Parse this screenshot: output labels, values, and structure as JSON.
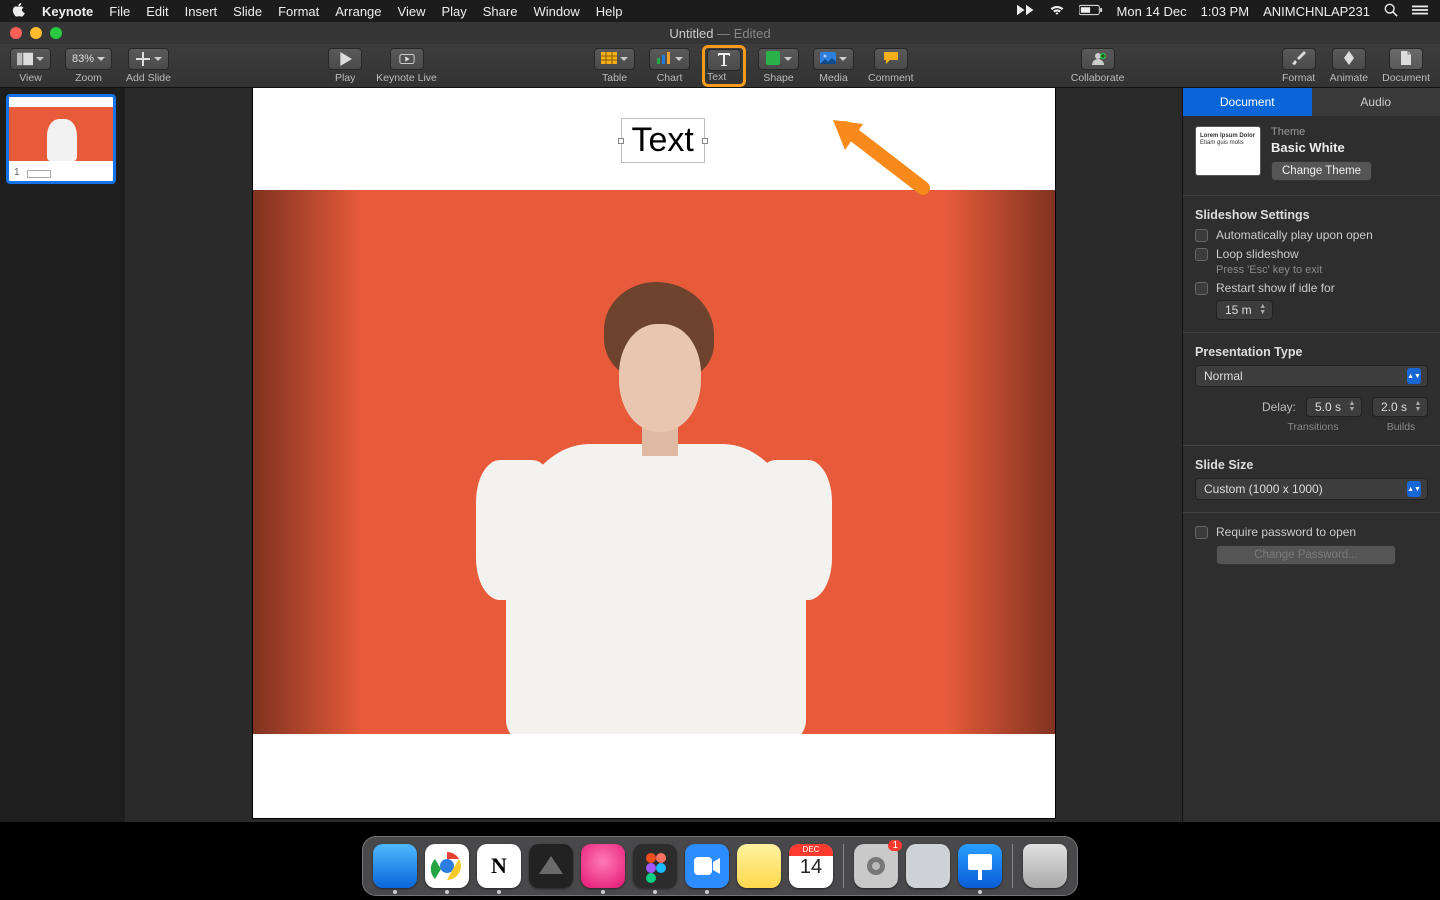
{
  "menubar": {
    "apple": "",
    "app": "Keynote",
    "items": [
      "File",
      "Edit",
      "Insert",
      "Slide",
      "Format",
      "Arrange",
      "View",
      "Play",
      "Share",
      "Window",
      "Help"
    ],
    "status": {
      "date": "Mon 14 Dec",
      "time": "1:03 PM",
      "user": "ANIMCHNLAP231"
    }
  },
  "window_title": {
    "name": "Untitled",
    "state": "— Edited"
  },
  "toolbar": {
    "view": "View",
    "zoom_group": "Zoom",
    "zoom_value": "83%",
    "add_slide": "Add Slide",
    "play": "Play",
    "keynote_live": "Keynote Live",
    "table": "Table",
    "chart": "Chart",
    "text": "Text",
    "shape": "Shape",
    "media": "Media",
    "comment": "Comment",
    "collaborate": "Collaborate",
    "format": "Format",
    "animate": "Animate",
    "document": "Document"
  },
  "navigator": {
    "slides": [
      {
        "num": "1"
      }
    ]
  },
  "canvas": {
    "textbox_value": "Text"
  },
  "inspector": {
    "tabs": {
      "document": "Document",
      "audio": "Audio"
    },
    "theme": {
      "label": "Theme",
      "name": "Basic White",
      "change": "Change Theme",
      "preview_line1": "Lorem Ipsum Dolor",
      "preview_line2": "Etiam guis molis"
    },
    "slideshow": {
      "heading": "Slideshow Settings",
      "auto_play": "Automatically play upon open",
      "loop": "Loop slideshow",
      "loop_hint": "Press 'Esc' key to exit",
      "restart": "Restart show if idle for",
      "idle_value": "15 m"
    },
    "pres_type": {
      "heading": "Presentation Type",
      "value": "Normal",
      "delay_label": "Delay:",
      "transitions_value": "5.0 s",
      "transitions_cap": "Transitions",
      "builds_value": "2.0 s",
      "builds_cap": "Builds"
    },
    "slide_size": {
      "heading": "Slide Size",
      "value": "Custom (1000 x 1000)"
    },
    "password": {
      "label": "Require password to open",
      "change": "Change Password..."
    }
  },
  "dock": {
    "apps": [
      {
        "name": "finder",
        "bg": "#1e8eff"
      },
      {
        "name": "chrome",
        "bg": "#f4f4f4"
      },
      {
        "name": "notion",
        "bg": "#ffffff"
      },
      {
        "name": "affinity",
        "bg": "#222"
      },
      {
        "name": "pink-app",
        "bg": "#ef3d82"
      },
      {
        "name": "figma",
        "bg": "#2c2c2c"
      },
      {
        "name": "zoom",
        "bg": "#2d8cff"
      },
      {
        "name": "notes",
        "bg": "#ffe46b"
      },
      {
        "name": "calendar",
        "bg": "#ffffff",
        "badge": "14"
      },
      {
        "name": "sysprefs",
        "bg": "#c9c9c9",
        "badge": "1"
      },
      {
        "name": "preview",
        "bg": "#cfd3d8"
      },
      {
        "name": "keynote",
        "bg": "#0a84ff"
      },
      {
        "name": "trash",
        "bg": "#d0d0d0"
      }
    ],
    "cal_label": "DEC"
  }
}
